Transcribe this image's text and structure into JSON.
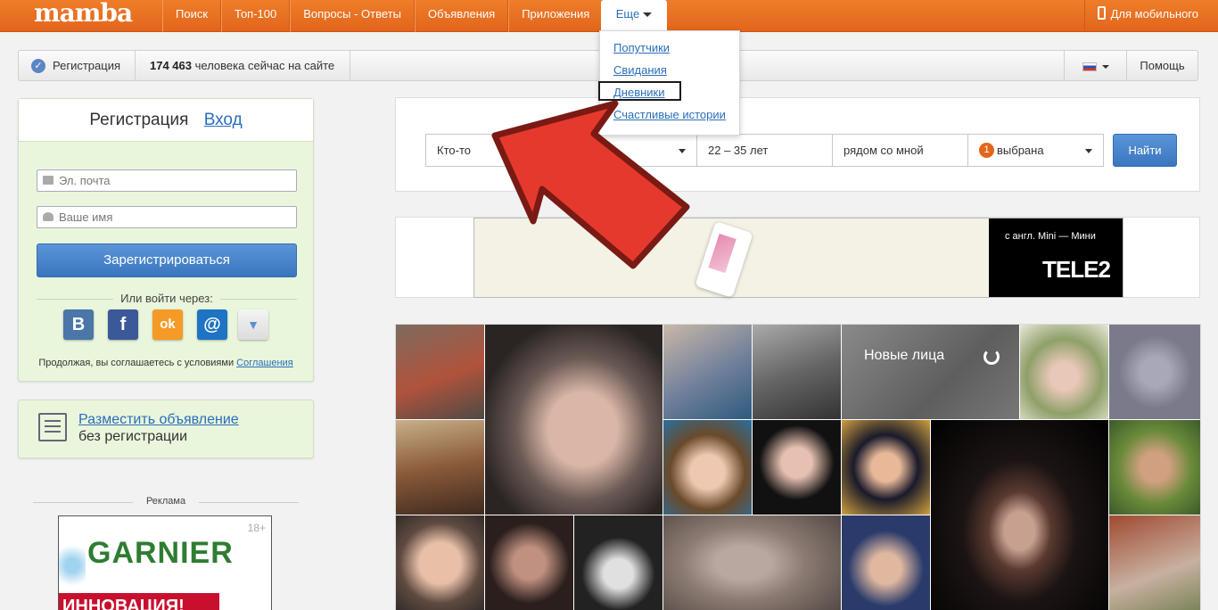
{
  "app": {
    "logo": "mamba"
  },
  "nav": {
    "items": [
      "Поиск",
      "Топ-100",
      "Вопросы - Ответы",
      "Объявления",
      "Приложения"
    ],
    "more": "Еще",
    "mobile": "Для мобильного"
  },
  "dropdown": {
    "items": [
      "Попутчики",
      "Свидания",
      "Дневники",
      "Счастливые истории"
    ],
    "highlighted": "Дневники"
  },
  "subbar": {
    "registration": "Регистрация",
    "online_count": "174 463",
    "online_text": "человека сейчас на сайте",
    "help": "Помощь"
  },
  "register": {
    "tab_active": "Регистрация",
    "tab_login": "Вход",
    "email_placeholder": "Эл. почта",
    "name_placeholder": "Ваше имя",
    "submit": "Зарегистрироваться",
    "or_login": "Или войти через:",
    "agree_text": "Продолжая, вы соглашаетесь с условиями",
    "agree_link": "Соглашения",
    "social": [
      {
        "name": "vk-icon",
        "glyph": "В",
        "color": "#4a76a8"
      },
      {
        "name": "facebook-icon",
        "glyph": "f",
        "color": "#3b5998"
      },
      {
        "name": "odnoklassniki-icon",
        "glyph": "ok",
        "color": "#f59a26"
      },
      {
        "name": "mailru-icon",
        "glyph": "@",
        "color": "#1e73c3"
      }
    ]
  },
  "ad_post": {
    "link": "Разместить объявление",
    "sub": "без регистрации"
  },
  "advert": {
    "label": "Реклама",
    "age": "18+",
    "brand": "GARNIER",
    "banner": "ИННОВАЦИЯ!"
  },
  "search": {
    "who": "Кто-то",
    "age": "22 – 35  лет",
    "where": "рядом со мной",
    "selected_count": "1",
    "selected_text": "выбрана",
    "find": "Найти"
  },
  "tele2": {
    "tag": "с англ. Mini — Мини",
    "brand": "TELE2"
  },
  "faces": {
    "title": "Новые лица"
  },
  "colors": {
    "accent": "#e2651b",
    "link": "#2a6ebb",
    "button": "#3a76bf",
    "green_panel": "#e9f6dc",
    "arrow": "#e6392e"
  }
}
